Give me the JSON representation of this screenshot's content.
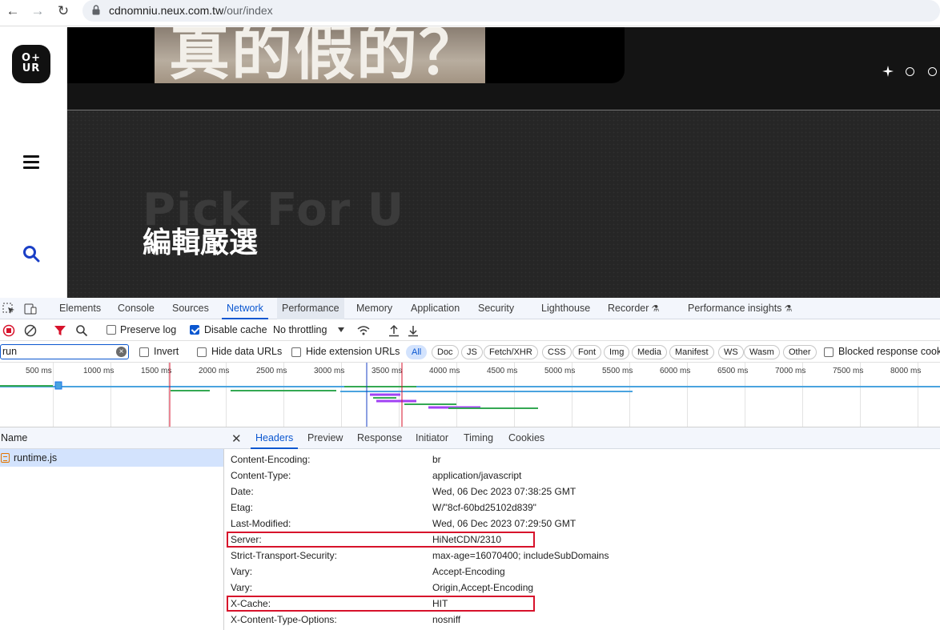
{
  "browser": {
    "url_host": "cdnomniu.neux.com.tw",
    "url_path": "/our/index"
  },
  "page": {
    "logo_text_top": "O+",
    "logo_text_bottom": "UR",
    "hero_image_text": "真的假的？",
    "pick_bg_text": "Pick For U",
    "pick_title": "編輯嚴選"
  },
  "devtools": {
    "tabs": [
      "Elements",
      "Console",
      "Sources",
      "Network",
      "Performance",
      "Memory",
      "Application",
      "Security",
      "Lighthouse",
      "Recorder",
      "Performance insights"
    ],
    "active_tab": "Network",
    "toolbar": {
      "preserve_log": "Preserve log",
      "disable_cache": "Disable cache",
      "throttling": "No throttling"
    },
    "filter": {
      "value": "run",
      "invert": "Invert",
      "hide_data_urls": "Hide data URLs",
      "hide_extension_urls": "Hide extension URLs",
      "chips": [
        "All",
        "Doc",
        "JS",
        "Fetch/XHR",
        "CSS",
        "Font",
        "Img",
        "Media",
        "Manifest",
        "WS",
        "Wasm",
        "Other"
      ],
      "blocked": "Blocked response cookies"
    },
    "timeline_ticks": [
      "500 ms",
      "1000 ms",
      "1500 ms",
      "2000 ms",
      "2500 ms",
      "3000 ms",
      "3500 ms",
      "4000 ms",
      "4500 ms",
      "5000 ms",
      "5500 ms",
      "6000 ms",
      "6500 ms",
      "7000 ms",
      "7500 ms",
      "8000 ms"
    ],
    "name_header": "Name",
    "request_name": "runtime.js",
    "detail_tabs": [
      "Headers",
      "Preview",
      "Response",
      "Initiator",
      "Timing",
      "Cookies"
    ],
    "headers": [
      {
        "key": "Content-Encoding:",
        "value": "br"
      },
      {
        "key": "Content-Type:",
        "value": "application/javascript"
      },
      {
        "key": "Date:",
        "value": "Wed, 06 Dec 2023 07:38:25 GMT"
      },
      {
        "key": "Etag:",
        "value": "W/\"8cf-60bd25102d839\""
      },
      {
        "key": "Last-Modified:",
        "value": "Wed, 06 Dec 2023 07:29:50 GMT"
      },
      {
        "key": "Server:",
        "value": "HiNetCDN/2310"
      },
      {
        "key": "Strict-Transport-Security:",
        "value": "max-age=16070400; includeSubDomains"
      },
      {
        "key": "Vary:",
        "value": "Accept-Encoding"
      },
      {
        "key": "Vary:",
        "value": "Origin,Accept-Encoding"
      },
      {
        "key": "X-Cache:",
        "value": "HIT"
      },
      {
        "key": "X-Content-Type-Options:",
        "value": "nosniff"
      }
    ],
    "highlight_color": "#d7122b",
    "accent_color": "#0b57d0"
  }
}
